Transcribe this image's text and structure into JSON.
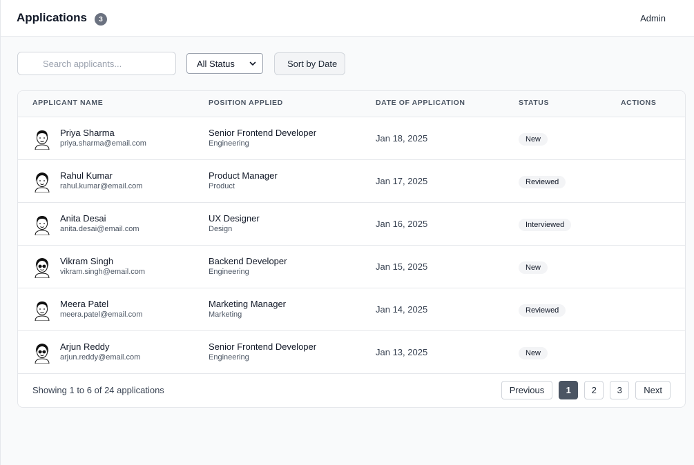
{
  "header": {
    "title": "Applications",
    "count": "3",
    "user": "Admin"
  },
  "toolbar": {
    "search_placeholder": "Search applicants...",
    "status_selected": "All Status",
    "sort_label": "Sort by Date"
  },
  "table": {
    "columns": [
      "APPLICANT NAME",
      "POSITION APPLIED",
      "DATE OF APPLICATION",
      "STATUS",
      "ACTIONS"
    ],
    "rows": [
      {
        "name": "Priya Sharma",
        "email": "priya.sharma@email.com",
        "position": "Senior Frontend Developer",
        "department": "Engineering",
        "date": "Jan 18, 2025",
        "status": "New"
      },
      {
        "name": "Rahul Kumar",
        "email": "rahul.kumar@email.com",
        "position": "Product Manager",
        "department": "Product",
        "date": "Jan 17, 2025",
        "status": "Reviewed"
      },
      {
        "name": "Anita Desai",
        "email": "anita.desai@email.com",
        "position": "UX Designer",
        "department": "Design",
        "date": "Jan 16, 2025",
        "status": "Interviewed"
      },
      {
        "name": "Vikram Singh",
        "email": "vikram.singh@email.com",
        "position": "Backend Developer",
        "department": "Engineering",
        "date": "Jan 15, 2025",
        "status": "New"
      },
      {
        "name": "Meera Patel",
        "email": "meera.patel@email.com",
        "position": "Marketing Manager",
        "department": "Marketing",
        "date": "Jan 14, 2025",
        "status": "Reviewed"
      },
      {
        "name": "Arjun Reddy",
        "email": "arjun.reddy@email.com",
        "position": "Senior Frontend Developer",
        "department": "Engineering",
        "date": "Jan 13, 2025",
        "status": "New"
      }
    ]
  },
  "footer": {
    "showing": "Showing 1 to 6 of 24 applications",
    "previous": "Previous",
    "pages": [
      "1",
      "2",
      "3"
    ],
    "current_page": "1",
    "next": "Next"
  },
  "icons": {
    "avatar": "avatar-illustration",
    "select": "chevron-down-icon"
  },
  "colors": {
    "active_page": "#4b5563",
    "badge_bg": "#f3f4f6"
  }
}
